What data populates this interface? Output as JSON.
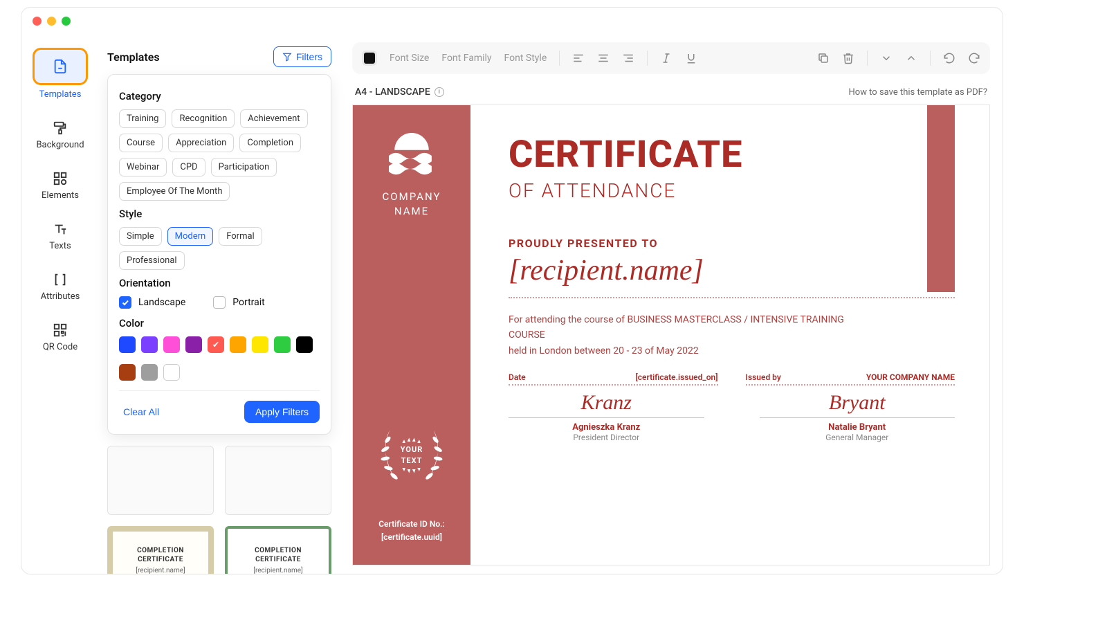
{
  "sidebar": {
    "items": [
      {
        "label": "Templates",
        "icon": "file-icon"
      },
      {
        "label": "Background",
        "icon": "roller-icon"
      },
      {
        "label": "Elements",
        "icon": "grid-icon"
      },
      {
        "label": "Texts",
        "icon": "text-icon"
      },
      {
        "label": "Attributes",
        "icon": "brackets-icon"
      },
      {
        "label": "QR Code",
        "icon": "qr-icon"
      }
    ],
    "active": "Templates"
  },
  "panel": {
    "title": "Templates",
    "filters_button": "Filters",
    "category_label": "Category",
    "categories": [
      "Training",
      "Recognition",
      "Achievement",
      "Course",
      "Appreciation",
      "Completion",
      "Webinar",
      "CPD",
      "Participation",
      "Employee Of The Month"
    ],
    "style_label": "Style",
    "styles": [
      "Simple",
      "Modern",
      "Formal",
      "Professional"
    ],
    "style_selected": "Modern",
    "orientation_label": "Orientation",
    "landscape_label": "Landscape",
    "portrait_label": "Portrait",
    "landscape_checked": true,
    "portrait_checked": false,
    "color_label": "Color",
    "colors": [
      {
        "hex": "#1f49ff"
      },
      {
        "hex": "#7b3fff"
      },
      {
        "hex": "#ff4ed8"
      },
      {
        "hex": "#8a1fa8"
      },
      {
        "hex": "#ff5a52",
        "checked": true
      },
      {
        "hex": "#ffa500"
      },
      {
        "hex": "#ffe600"
      },
      {
        "hex": "#2ecc40"
      },
      {
        "hex": "#000000"
      },
      {
        "hex": "#a63e12"
      },
      {
        "hex": "#9e9e9e"
      },
      {
        "hex": "#ffffff",
        "white": true
      }
    ],
    "clear_all": "Clear All",
    "apply_filters": "Apply Filters",
    "result_cards": [
      {
        "title": "",
        "sub": ""
      },
      {
        "title": "",
        "sub": ""
      },
      {
        "title": "COMPLETION CERTIFICATE",
        "sub": "[recipient.name]"
      },
      {
        "title": "COMPLETION CERTIFICATE",
        "sub": "[recipient.name]"
      }
    ]
  },
  "toolbar": {
    "font_size": "Font Size",
    "font_family": "Font Family",
    "font_style": "Font Style"
  },
  "canvas_header": {
    "format": "A4 - LANDSCAPE",
    "help_link": "How to save this template as PDF?"
  },
  "certificate": {
    "company_lines": [
      "COMPANY",
      "NAME"
    ],
    "your_text_lines": [
      "YOUR",
      "TEXT"
    ],
    "id_label": "Certificate ID No.:",
    "id_value": "[certificate.uuid]",
    "title": "CERTIFICATE",
    "subtitle": "OF ATTENDANCE",
    "presented_to": "PROUDLY PRESENTED TO",
    "recipient": "[recipient.name]",
    "description_line1": "For attending the course of BUSINESS MASTERCLASS / INTENSIVE TRAINING COURSE",
    "description_line2": "held in London between 20 - 23 of May 2022",
    "date_label": "Date",
    "date_value": "[certificate.issued_on]",
    "issued_by_label": "Issued by",
    "issued_by_value": "YOUR COMPANY NAME",
    "signature_a": {
      "script": "Kranz",
      "name": "Agnieszka Kranz",
      "role": "President Director"
    },
    "signature_b": {
      "script": "Bryant",
      "name": "Natalie Bryant",
      "role": "General Manager"
    }
  }
}
